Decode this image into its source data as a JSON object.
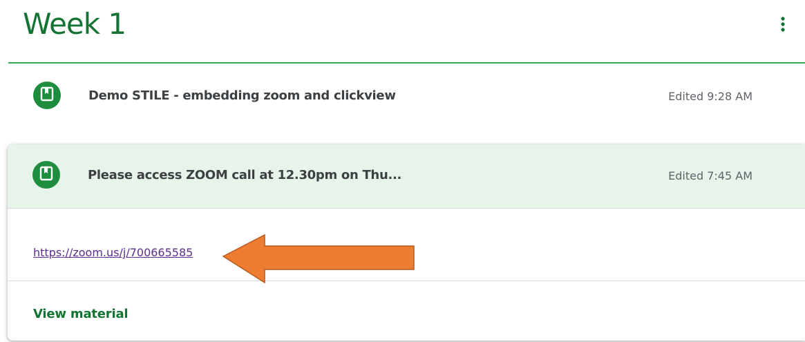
{
  "topic": {
    "title": "Week 1"
  },
  "items": [
    {
      "title": "Demo STILE - embedding zoom and clickview",
      "meta": "Edited 9:28 AM"
    },
    {
      "title": "Please access ZOOM call at 12.30pm on Thu...",
      "meta": "Edited 7:45 AM",
      "link": "https://zoom.us/j/700665585",
      "action": "View material"
    }
  ],
  "icons": {
    "more": "more-vert-icon",
    "material": "book-icon",
    "annotation": "arrow-left-icon"
  },
  "colors": {
    "accent_green": "#137333",
    "icon_green": "#1e8e3e",
    "divider_green": "#34a853",
    "expanded_bg": "#e6f4ea",
    "link_purple": "#5c2d91",
    "arrow_orange": "#ed7d31"
  }
}
